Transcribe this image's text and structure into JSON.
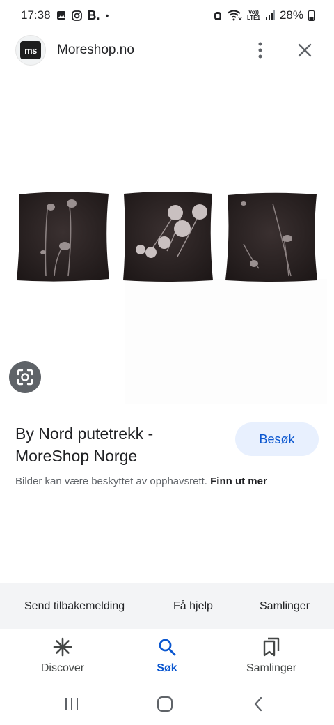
{
  "status_bar": {
    "time": "17:38",
    "b_label": "B.",
    "volte_top": "Vo))",
    "volte_bottom": "LTE1",
    "battery": "28%"
  },
  "header": {
    "logo_text": "ms",
    "site_name": "Moreshop.no"
  },
  "result": {
    "title_line1": "By Nord putetrekk -",
    "title_line2": "MoreShop Norge",
    "visit_label": "Besøk",
    "copyright_text": "Bilder kan være beskyttet av opphavsrett. ",
    "learn_more": "Finn ut mer"
  },
  "footer_links": {
    "feedback": "Send tilbakemelding",
    "help": "Få hjelp",
    "collections": "Samlinger"
  },
  "bottom_nav": {
    "discover": "Discover",
    "search": "Søk",
    "collections": "Samlinger"
  },
  "colors": {
    "accent": "#0b57d0",
    "visit_bg": "#e8f0fe",
    "pillow": "#2a2222"
  }
}
